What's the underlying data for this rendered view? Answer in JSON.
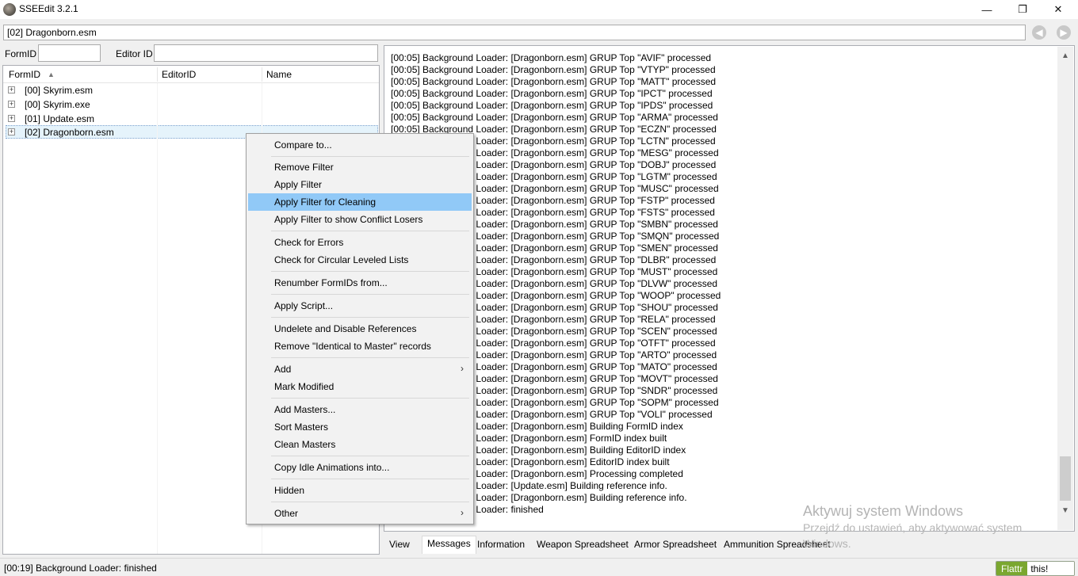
{
  "window": {
    "title": "SSEEdit 3.2.1",
    "minimize": "—",
    "maximize": "❐",
    "close": "✕"
  },
  "pathbar": {
    "value": "[02] Dragonborn.esm",
    "back": "◀",
    "forward": "▶"
  },
  "filter": {
    "formid_label": "FormID",
    "formid_value": "",
    "editorid_label": "Editor ID",
    "editorid_value": ""
  },
  "tree": {
    "columns": {
      "formid": "FormID",
      "sort_arrow": "▲",
      "editorid": "EditorID",
      "name": "Name"
    },
    "rows": [
      {
        "expander": "+",
        "label": "[00] Skyrim.esm"
      },
      {
        "expander": "+",
        "label": "[00] Skyrim.exe"
      },
      {
        "expander": "+",
        "label": "[01] Update.esm"
      },
      {
        "expander": "+",
        "label": "[02] Dragonborn.esm"
      }
    ]
  },
  "messages": {
    "lines": [
      "[00:05] Background Loader: [Dragonborn.esm] GRUP Top \"AVIF\" processed",
      "[00:05] Background Loader: [Dragonborn.esm] GRUP Top \"VTYP\" processed",
      "[00:05] Background Loader: [Dragonborn.esm] GRUP Top \"MATT\" processed",
      "[00:05] Background Loader: [Dragonborn.esm] GRUP Top \"IPCT\" processed",
      "[00:05] Background Loader: [Dragonborn.esm] GRUP Top \"IPDS\" processed",
      "[00:05] Background Loader: [Dragonborn.esm] GRUP Top \"ARMA\" processed",
      "[00:05] Background Loader: [Dragonborn.esm] GRUP Top \"ECZN\" processed",
      "[00:05] Background Loader: [Dragonborn.esm] GRUP Top \"LCTN\" processed",
      "[00:05] Background Loader: [Dragonborn.esm] GRUP Top \"MESG\" processed",
      "[00:05] Background Loader: [Dragonborn.esm] GRUP Top \"DOBJ\" processed",
      "[00:05] Background Loader: [Dragonborn.esm] GRUP Top \"LGTM\" processed",
      "[00:05] Background Loader: [Dragonborn.esm] GRUP Top \"MUSC\" processed",
      "[00:05] Background Loader: [Dragonborn.esm] GRUP Top \"FSTP\" processed",
      "[00:05] Background Loader: [Dragonborn.esm] GRUP Top \"FSTS\" processed",
      "[00:05] Background Loader: [Dragonborn.esm] GRUP Top \"SMBN\" processed",
      "[00:05] Background Loader: [Dragonborn.esm] GRUP Top \"SMQN\" processed",
      "[00:05] Background Loader: [Dragonborn.esm] GRUP Top \"SMEN\" processed",
      "[00:05] Background Loader: [Dragonborn.esm] GRUP Top \"DLBR\" processed",
      "[00:05] Background Loader: [Dragonborn.esm] GRUP Top \"MUST\" processed",
      "[00:05] Background Loader: [Dragonborn.esm] GRUP Top \"DLVW\" processed",
      "[00:05] Background Loader: [Dragonborn.esm] GRUP Top \"WOOP\" processed",
      "[00:05] Background Loader: [Dragonborn.esm] GRUP Top \"SHOU\" processed",
      "[00:05] Background Loader: [Dragonborn.esm] GRUP Top \"RELA\" processed",
      "[00:05] Background Loader: [Dragonborn.esm] GRUP Top \"SCEN\" processed",
      "[00:05] Background Loader: [Dragonborn.esm] GRUP Top \"OTFT\" processed",
      "[00:05] Background Loader: [Dragonborn.esm] GRUP Top \"ARTO\" processed",
      "[00:05] Background Loader: [Dragonborn.esm] GRUP Top \"MATO\" processed",
      "[00:05] Background Loader: [Dragonborn.esm] GRUP Top \"MOVT\" processed",
      "[00:05] Background Loader: [Dragonborn.esm] GRUP Top \"SNDR\" processed",
      "[00:05] Background Loader: [Dragonborn.esm] GRUP Top \"SOPM\" processed",
      "[00:05] Background Loader: [Dragonborn.esm] GRUP Top \"VOLI\" processed",
      "[00:05] Background Loader: [Dragonborn.esm] Building FormID index",
      "[00:05] Background Loader: [Dragonborn.esm] FormID index built",
      "[00:05] Background Loader: [Dragonborn.esm] Building EditorID index",
      "[00:05] Background Loader: [Dragonborn.esm] EditorID index built",
      "[00:05] Background Loader: [Dragonborn.esm] Processing completed",
      "[00:05] Background Loader: [Update.esm] Building reference info.",
      "[00:05] Background Loader: [Dragonborn.esm] Building reference info.",
      "[00:19] Background Loader: finished"
    ],
    "scroll_up": "▲",
    "scroll_down": "▼"
  },
  "tabs": [
    "View",
    "Messages",
    "Information",
    "Weapon Spreadsheet",
    "Armor Spreadsheet",
    "Ammunition Spreadsheet"
  ],
  "watermark": {
    "line1": "Aktywuj system Windows",
    "line2": "Przejdź do ustawień, aby aktywować system",
    "line3": "Windows."
  },
  "status": {
    "text": "[00:19] Background Loader: finished"
  },
  "flattr": {
    "left": "Flattr",
    "right": "this!"
  },
  "context_menu": {
    "items": {
      "compare": "Compare to...",
      "remove_filter": "Remove Filter",
      "apply_filter": "Apply Filter",
      "apply_filter_cleaning": "Apply Filter for Cleaning",
      "apply_filter_conflict": "Apply Filter to show Conflict Losers",
      "check_errors": "Check for Errors",
      "check_circular": "Check for Circular Leveled Lists",
      "renumber": "Renumber FormIDs from...",
      "apply_script": "Apply Script...",
      "undelete": "Undelete and Disable References",
      "remove_itm": "Remove \"Identical to Master\" records",
      "add": "Add",
      "mark_modified": "Mark Modified",
      "add_masters": "Add Masters...",
      "sort_masters": "Sort Masters",
      "clean_masters": "Clean Masters",
      "copy_idle": "Copy Idle Animations into...",
      "hidden": "Hidden",
      "other": "Other"
    },
    "submenu_arrow": "›",
    "highlight_color": "#91c9f7"
  }
}
